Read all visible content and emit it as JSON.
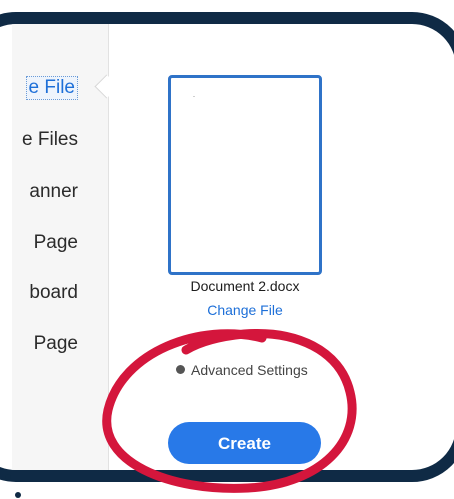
{
  "sidebar": {
    "items": [
      {
        "label": "e File",
        "active": true
      },
      {
        "label": "e Files",
        "active": false
      },
      {
        "label": "anner",
        "active": false
      },
      {
        "label": "Page",
        "active": false
      },
      {
        "label": "board",
        "active": false
      },
      {
        "label": "Page",
        "active": false
      }
    ]
  },
  "document": {
    "filename": "Document 2.docx",
    "change_label": "Change File"
  },
  "advanced_settings": {
    "label": "Advanced Settings",
    "icon": "settings-dot-icon"
  },
  "create_button": {
    "label": "Create"
  },
  "colors": {
    "frame": "#0f2a45",
    "accent": "#2879e8",
    "link": "#1d6fd8",
    "highlight_ring": "#d4163c"
  }
}
